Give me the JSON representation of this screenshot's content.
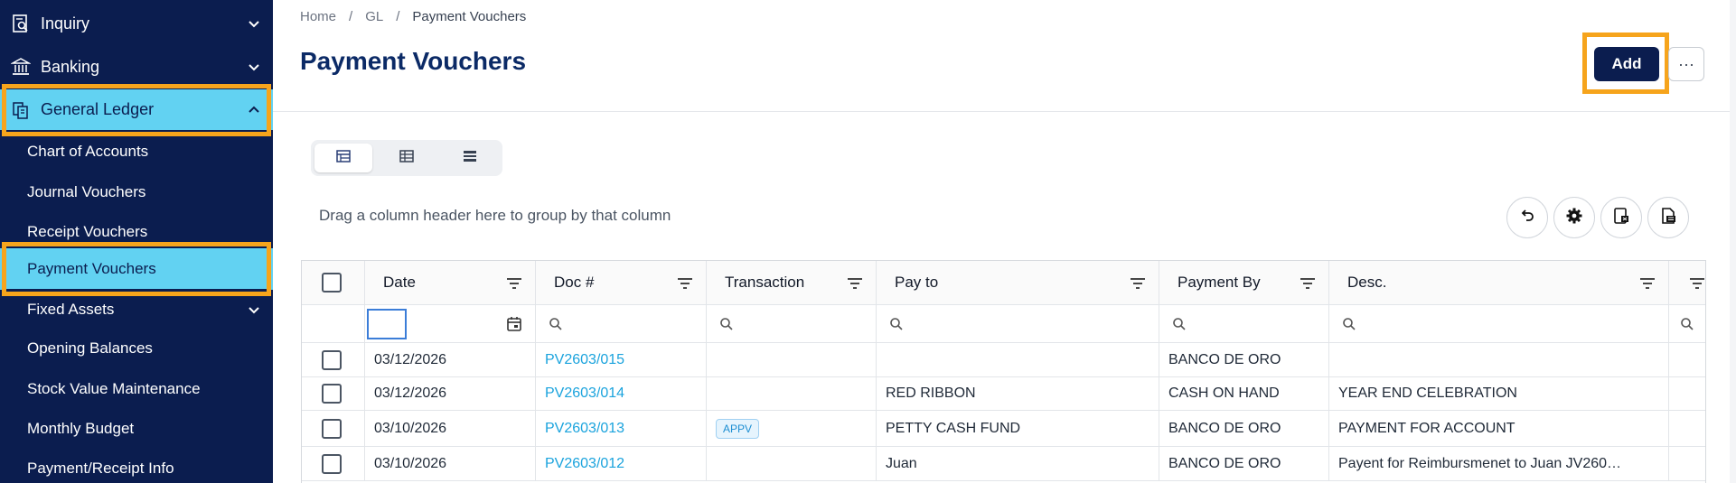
{
  "sidebar": {
    "items": [
      {
        "label": "Inquiry",
        "icon": "search-doc-icon"
      },
      {
        "label": "Banking",
        "icon": "bank-icon"
      },
      {
        "label": "General Ledger",
        "icon": "ledger-icon"
      }
    ],
    "sub_items": [
      {
        "label": "Chart of Accounts"
      },
      {
        "label": "Journal Vouchers"
      },
      {
        "label": "Receipt Vouchers"
      },
      {
        "label": "Payment Vouchers"
      }
    ],
    "fixed_assets": {
      "label": "Fixed Assets"
    },
    "more_items": [
      {
        "label": "Opening Balances"
      },
      {
        "label": "Stock Value Maintenance"
      },
      {
        "label": "Monthly Budget"
      },
      {
        "label": "Payment/Receipt Info"
      }
    ]
  },
  "breadcrumb": {
    "home": "Home",
    "sep1": "/",
    "gl": "GL",
    "sep2": "/",
    "current": "Payment Vouchers"
  },
  "page": {
    "title": "Payment Vouchers",
    "add_label": "Add",
    "more_label": "···"
  },
  "grid": {
    "group_hint": "Drag a column header here to group by that column",
    "columns": [
      "Date",
      "Doc #",
      "Transaction",
      "Pay to",
      "Payment By",
      "Desc."
    ],
    "rows": [
      {
        "date": "03/12/2026",
        "doc": "PV2603/015",
        "transaction": "",
        "pay_to": "",
        "payment_by": "BANCO DE ORO",
        "desc": ""
      },
      {
        "date": "03/12/2026",
        "doc": "PV2603/014",
        "transaction": "",
        "pay_to": "RED RIBBON",
        "payment_by": "CASH ON HAND",
        "desc": "YEAR END CELEBRATION"
      },
      {
        "date": "03/10/2026",
        "doc": "PV2603/013",
        "transaction": "APPV",
        "pay_to": "PETTY CASH FUND",
        "payment_by": "BANCO DE ORO",
        "desc": "PAYMENT FOR ACCOUNT"
      },
      {
        "date": "03/10/2026",
        "doc": "PV2603/012",
        "transaction": "",
        "pay_to": "Juan",
        "payment_by": "BANCO DE ORO",
        "desc": "Payent for Reimbursmenet to Juan JV260…"
      }
    ]
  },
  "colors": {
    "sidebar_bg": "#0b1d4f",
    "active_bg": "#62d2f2",
    "highlight": "#f6a41c",
    "link": "#1aa3dd",
    "title": "#0b2a66"
  }
}
